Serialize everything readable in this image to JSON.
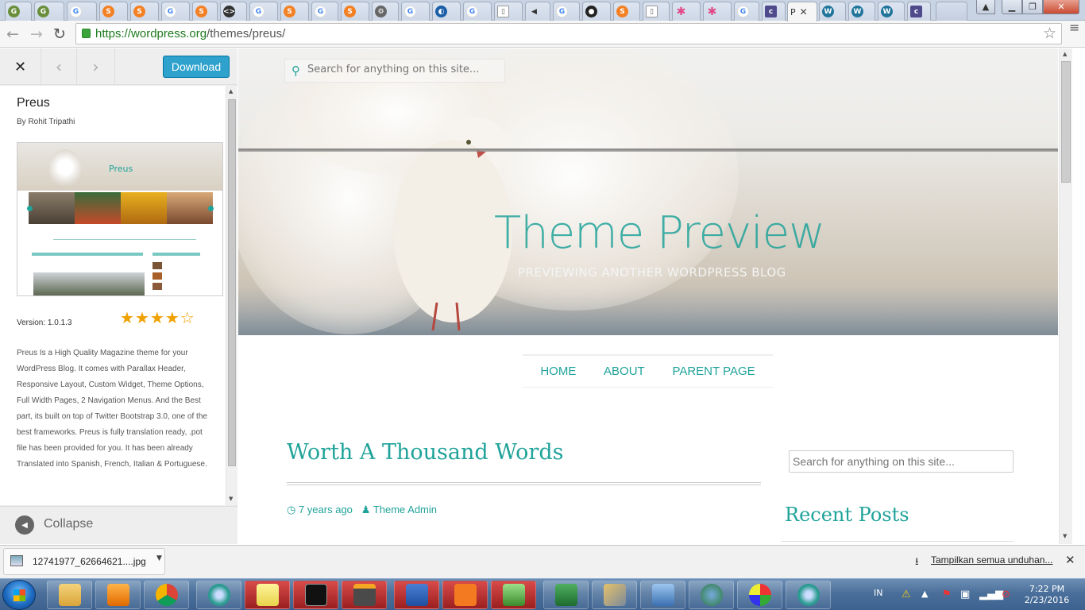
{
  "browser": {
    "active_tab_label": "P",
    "url_host": "https://wordpress.org",
    "url_path": "/themes/preus/"
  },
  "sidebar": {
    "download_label": "Download",
    "theme_name": "Preus",
    "author": "By Rohit Tripathi",
    "version": "Version: 1.0.1.3",
    "rating": 4,
    "rating_max": 5,
    "description": "Preus Is a High Quality Magazine theme for your WordPress Blog. It comes with Parallax Header, Responsive Layout, Custom Widget, Theme Options, Full Width Pages, 2 Navigation Menus. And the Best part, its built on top of Twitter Bootstrap 3.0, one of the best frameworks. Preus is fully translation ready, .pot file has been provided for you. It has been already Translated into Spanish, French, Italian & Portuguese.",
    "collapse_label": "Collapse",
    "screenshot_title": "Preus"
  },
  "preview": {
    "search_placeholder": "Search for anything on this site...",
    "site_title": "Theme Preview",
    "tagline": "PREVIEWING ANOTHER WORDPRESS BLOG",
    "nav": [
      "HOME",
      "ABOUT",
      "PARENT PAGE"
    ],
    "post_title": "Worth A Thousand Words",
    "post_date": "7 years ago",
    "post_author": "Theme Admin",
    "widget_search_placeholder": "Search for anything on this site...",
    "recent_posts_title": "Recent Posts",
    "accent_color": "#20a39a"
  },
  "downloads": {
    "file_name": "12741977_62664621....jpg",
    "show_all": "Tampilkan semua unduhan..."
  },
  "taskbar": {
    "language": "IN",
    "time": "7:22 PM",
    "date": "2/23/2016"
  }
}
